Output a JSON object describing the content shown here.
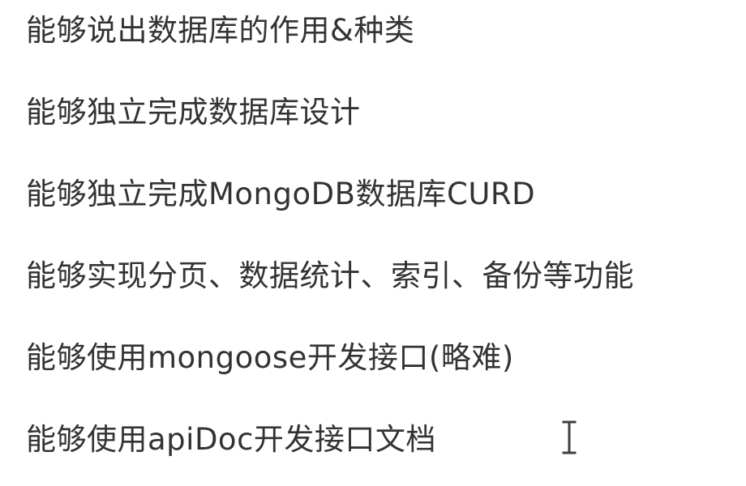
{
  "items": [
    "能够说出数据库的作用&种类",
    "能够独立完成数据库设计",
    "能够独立完成MongoDB数据库CURD",
    "能够实现分页、数据统计、索引、备份等功能",
    "能够使用mongoose开发接口(略难)",
    "能够使用apiDoc开发接口文档"
  ],
  "cursor": {
    "icon": "text-cursor-icon"
  }
}
